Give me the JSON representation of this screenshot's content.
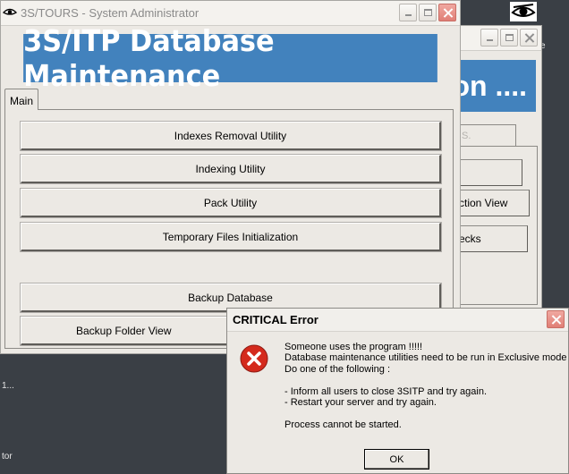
{
  "desktop": {
    "cut_dots": "1...",
    "cut_tor": "tor",
    "cut_e": "e"
  },
  "back_window": {
    "banner_fragment": "on ....",
    "tab_fragment": "S.",
    "buttons": [
      "",
      "ction View",
      "ecks"
    ]
  },
  "main_window": {
    "title": "3S/TOURS - System Administrator",
    "banner": "3S/ITP Database Maintenance",
    "tab": "Main",
    "buttons": {
      "indexes_removal": "Indexes Removal Utility",
      "indexing": "Indexing Utility",
      "pack": "Pack Utility",
      "temp_files": "Temporary Files Initialization",
      "backup_db": "Backup Database",
      "backup_folder": "Backup Folder View"
    }
  },
  "dialog": {
    "title": "CRITICAL Error",
    "message": "Someone uses the program !!!!!\nDatabase maintenance utilities need to be run in Exclusive mode\nDo one of the following :\n\n- Inform all users to close 3SITP and try again.\n- Restart your server and try again.\n\nProcess cannot be started.",
    "ok_label": "OK"
  },
  "colors": {
    "banner_blue": "#4282bd",
    "window_bg": "#ece9e4",
    "close_red": "#e07f76",
    "error_red": "#d42a1d"
  }
}
